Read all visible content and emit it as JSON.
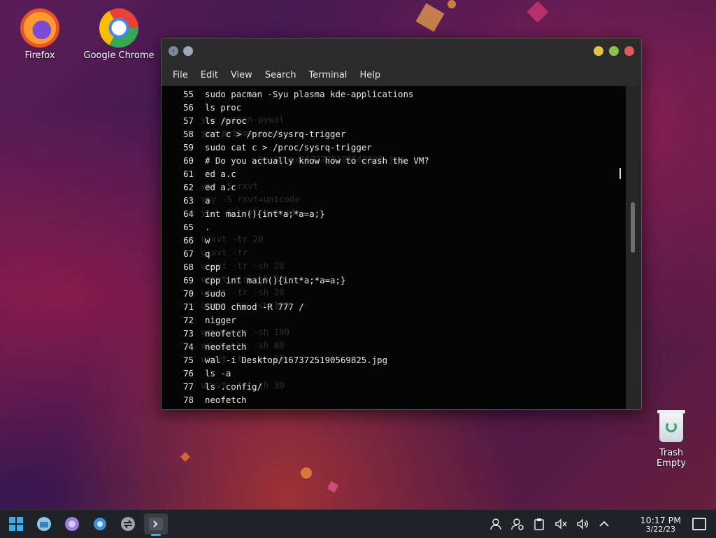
{
  "desktop": {
    "icons": [
      {
        "label": "Firefox"
      },
      {
        "label": "Google Chrome"
      }
    ],
    "trash": {
      "label": "Trash",
      "status": "Empty"
    }
  },
  "terminal": {
    "menu": [
      "File",
      "Edit",
      "View",
      "Search",
      "Terminal",
      "Help"
    ],
    "lines": [
      {
        "n": "55",
        "cmd": "sudo pacman -Syu plasma kde-applications"
      },
      {
        "n": "56",
        "cmd": "ls proc"
      },
      {
        "n": "57",
        "cmd": "ls /proc"
      },
      {
        "n": "58",
        "cmd": "cat c > /proc/sysrq-trigger"
      },
      {
        "n": "59",
        "cmd": "sudo cat c > /proc/sysrq-trigger"
      },
      {
        "n": "60",
        "cmd": "# Do you actually know how to crash the VM?"
      },
      {
        "n": "61",
        "cmd": "ed a.c"
      },
      {
        "n": "62",
        "cmd": "ed a.c"
      },
      {
        "n": "63",
        "cmd": "a"
      },
      {
        "n": "64",
        "cmd": "int main(){int*a;*a=a;}"
      },
      {
        "n": "65",
        "cmd": "."
      },
      {
        "n": "66",
        "cmd": "w"
      },
      {
        "n": "67",
        "cmd": "q"
      },
      {
        "n": "68",
        "cmd": "cpp"
      },
      {
        "n": "69",
        "cmd": "cpp int main(){int*a;*a=a;}"
      },
      {
        "n": "70",
        "cmd": "sudo"
      },
      {
        "n": "71",
        "cmd": "SUDO chmod -R 777 /"
      },
      {
        "n": "72",
        "cmd": "nigger"
      },
      {
        "n": "73",
        "cmd": "neofetch"
      },
      {
        "n": "74",
        "cmd": "neofetch"
      },
      {
        "n": "75",
        "cmd": "wal -i Desktop/1673725190569825.jpg"
      },
      {
        "n": "76",
        "cmd": "ls -a"
      },
      {
        "n": "77",
        "cmd": "ls .config/"
      },
      {
        "n": "78",
        "cmd": "neofetch"
      }
    ],
    "ghost_text": "\n\n       yay python-pywal\n       yay python-pywal\n\n                  Desktop/1673725190569825.jpg\n\n       yay -S rxvt\n       yay -S rxvt=unicode\n       yay -S rxvt-unicode\n\n       urxvt -tr 20\n       urxvt -tr\n       urxvt -tr -sh 20\n       urxvt -tr -sh 20\n       urxvt -tr -sh 20\n       urxvt -tr -sh 120\n\n       urxvt -tr -sh 190\n       urxvt -tr -sh 80\n       urxvt -tr -sh 30\n\n       urxvt -tr -sh 30"
  },
  "taskbar": {
    "clock_time": "10:17 PM",
    "clock_date": "3/22/23"
  },
  "colors": {
    "accent": "#3daee9",
    "min": "#e6c24a",
    "max": "#8bc34a",
    "close": "#e05a5a"
  }
}
